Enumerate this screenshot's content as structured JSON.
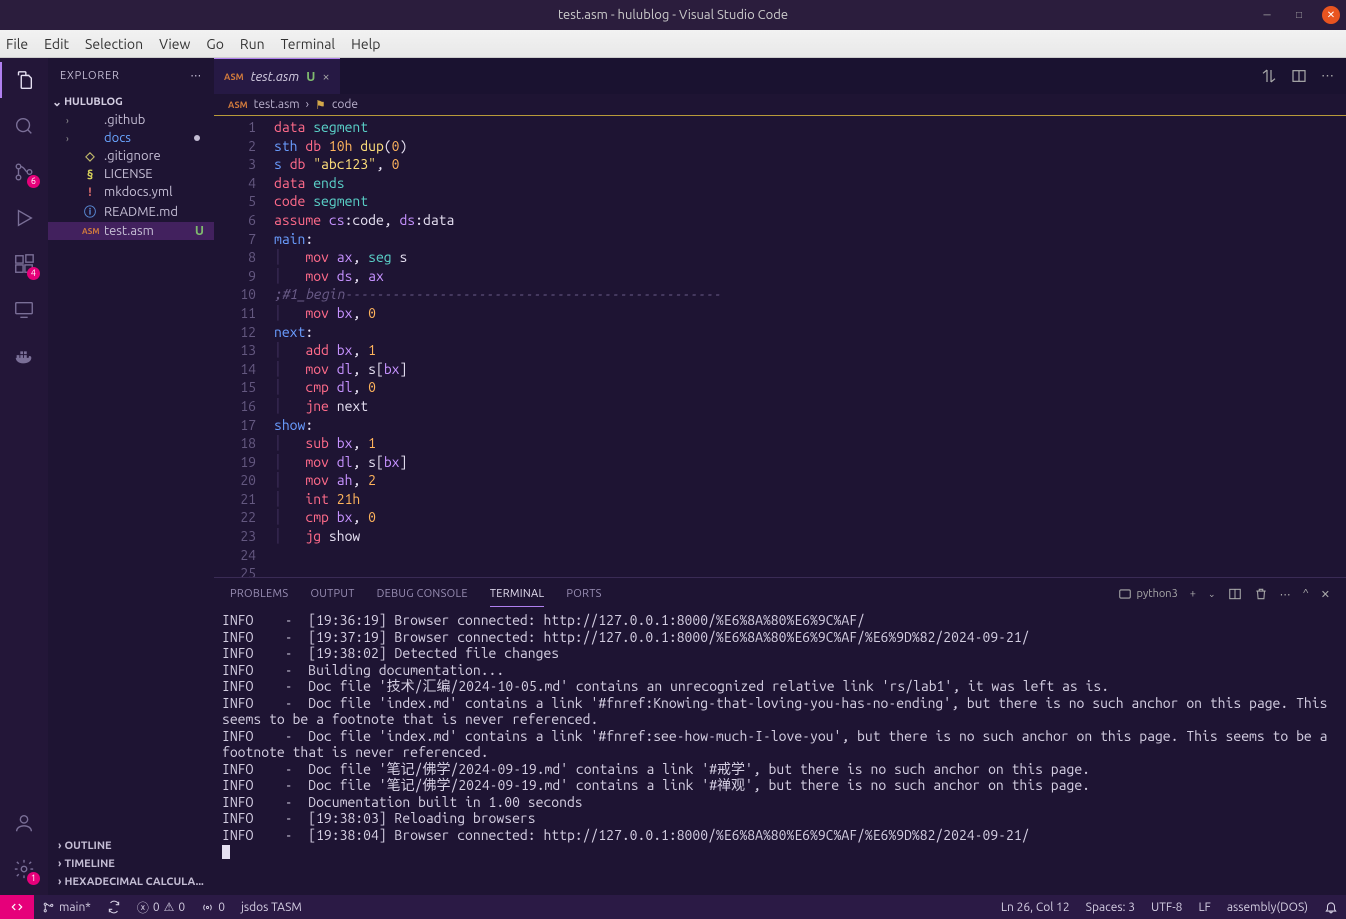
{
  "window": {
    "title": "test.asm - hulublog - Visual Studio Code"
  },
  "menu": {
    "file": "File",
    "edit": "Edit",
    "selection": "Selection",
    "view": "View",
    "go": "Go",
    "run": "Run",
    "terminal": "Terminal",
    "help": "Help"
  },
  "activity": {
    "source_control_badge": "6",
    "extensions_badge": "4",
    "settings_badge": "1"
  },
  "sidebar": {
    "header": "EXPLORER",
    "root": "HULUBLOG",
    "items": [
      {
        "chev": "›",
        "ico": "",
        "label": ".github",
        "color": "#c4bdd4"
      },
      {
        "chev": "›",
        "ico": "",
        "label": "docs",
        "color": "#6aa5ff",
        "dot": true
      },
      {
        "chev": "",
        "ico": "◇",
        "label": ".gitignore",
        "icocolor": "#c0b86a"
      },
      {
        "chev": "",
        "ico": "§",
        "label": "LICENSE",
        "icocolor": "#d6d05a"
      },
      {
        "chev": "",
        "ico": "!",
        "label": "mkdocs.yml",
        "icocolor": "#d66a6a"
      },
      {
        "chev": "",
        "ico": "ⓘ",
        "label": "README.md",
        "icocolor": "#5a8bd6"
      },
      {
        "chev": "",
        "ico": "ASM",
        "label": "test.asm",
        "icocolor": "#d27b3c",
        "mod": "U",
        "active": true
      }
    ],
    "outline": "OUTLINE",
    "timeline": "TIMELINE",
    "hexcalc": "HEXADECIMAL CALCULA..."
  },
  "tab": {
    "fileicon": "ASM",
    "filename": "test.asm",
    "mod": "U",
    "close": "×"
  },
  "breadcrumb": {
    "fileicon": "ASM",
    "file": "test.asm",
    "symicon": "⚙",
    "symbol": "code"
  },
  "code_lines": [
    [
      [
        "data ",
        "t-red"
      ],
      [
        "segment",
        "t-cyan"
      ]
    ],
    [
      [
        "sth ",
        "t-blue"
      ],
      [
        "db ",
        "t-red"
      ],
      [
        "10h ",
        "t-orange"
      ],
      [
        "dup",
        "t-yellow"
      ],
      [
        "(",
        "w"
      ],
      [
        "0",
        "t-orange"
      ],
      [
        ")",
        "w"
      ]
    ],
    [
      [
        "s ",
        "t-blue"
      ],
      [
        "db ",
        "t-red"
      ],
      [
        "\"abc123\"",
        "t-str"
      ],
      [
        ",",
        "w"
      ],
      [
        " 0",
        "t-orange"
      ]
    ],
    [
      [
        "data ",
        "t-red"
      ],
      [
        "ends",
        "t-cyan"
      ]
    ],
    [
      [
        "",
        "w"
      ]
    ],
    [
      [
        "code ",
        "t-red"
      ],
      [
        "segment",
        "t-cyan"
      ]
    ],
    [
      [
        "assume ",
        "t-red"
      ],
      [
        "cs",
        "t-purple"
      ],
      [
        ":code, ",
        "w"
      ],
      [
        "ds",
        "t-purple"
      ],
      [
        ":data",
        "w"
      ]
    ],
    [
      [
        "main",
        "t-blue"
      ],
      [
        ":",
        "w"
      ]
    ],
    [
      [
        "│   ",
        "guide"
      ],
      [
        "mov ",
        "t-red"
      ],
      [
        "ax",
        "t-purple"
      ],
      [
        ",",
        "w"
      ],
      [
        " seg ",
        "t-cyan"
      ],
      [
        "s",
        "w"
      ]
    ],
    [
      [
        "│   ",
        "guide"
      ],
      [
        "mov ",
        "t-red"
      ],
      [
        "ds",
        "t-purple"
      ],
      [
        ",",
        "w"
      ],
      [
        " ax",
        "t-purple"
      ]
    ],
    [
      [
        ";#1_begin------------------------------------------------",
        "t-comment"
      ]
    ],
    [
      [
        "│   ",
        "guide"
      ],
      [
        "mov ",
        "t-red"
      ],
      [
        "bx",
        "t-purple"
      ],
      [
        ",",
        "w"
      ],
      [
        " 0",
        "t-orange"
      ]
    ],
    [
      [
        "next",
        "t-blue"
      ],
      [
        ":",
        "w"
      ]
    ],
    [
      [
        "│   ",
        "guide"
      ],
      [
        "add ",
        "t-red"
      ],
      [
        "bx",
        "t-purple"
      ],
      [
        ",",
        "w"
      ],
      [
        " 1",
        "t-orange"
      ]
    ],
    [
      [
        "│   ",
        "guide"
      ],
      [
        "mov ",
        "t-red"
      ],
      [
        "dl",
        "t-purple"
      ],
      [
        ",",
        "w"
      ],
      [
        " s",
        "w"
      ],
      [
        "[",
        "w"
      ],
      [
        "bx",
        "t-purple"
      ],
      [
        "]",
        "w"
      ]
    ],
    [
      [
        "│   ",
        "guide"
      ],
      [
        "cmp ",
        "t-red"
      ],
      [
        "dl",
        "t-purple"
      ],
      [
        ",",
        "w"
      ],
      [
        " 0",
        "t-orange"
      ]
    ],
    [
      [
        "│   ",
        "guide"
      ],
      [
        "jne ",
        "t-red"
      ],
      [
        "next",
        "w"
      ]
    ],
    [
      [
        "",
        "w"
      ]
    ],
    [
      [
        "show",
        "t-blue"
      ],
      [
        ":",
        "w"
      ]
    ],
    [
      [
        "│   ",
        "guide"
      ],
      [
        "sub ",
        "t-red"
      ],
      [
        "bx",
        "t-purple"
      ],
      [
        ",",
        "w"
      ],
      [
        " 1",
        "t-orange"
      ]
    ],
    [
      [
        "│   ",
        "guide"
      ],
      [
        "mov ",
        "t-red"
      ],
      [
        "dl",
        "t-purple"
      ],
      [
        ",",
        "w"
      ],
      [
        " s",
        "w"
      ],
      [
        "[",
        "w"
      ],
      [
        "bx",
        "t-purple"
      ],
      [
        "]",
        "w"
      ]
    ],
    [
      [
        "│   ",
        "guide"
      ],
      [
        "mov ",
        "t-red"
      ],
      [
        "ah",
        "t-purple"
      ],
      [
        ",",
        "w"
      ],
      [
        " 2",
        "t-orange"
      ]
    ],
    [
      [
        "│   ",
        "guide"
      ],
      [
        "int ",
        "t-red"
      ],
      [
        "21h",
        "t-orange"
      ]
    ],
    [
      [
        "│   ",
        "guide"
      ],
      [
        "cmp ",
        "t-red"
      ],
      [
        "bx",
        "t-purple"
      ],
      [
        ",",
        "w"
      ],
      [
        " 0",
        "t-orange"
      ]
    ],
    [
      [
        "│   ",
        "guide"
      ],
      [
        "jg ",
        "t-red"
      ],
      [
        "show",
        "w"
      ]
    ]
  ],
  "panel": {
    "problems": "PROBLEMS",
    "output": "OUTPUT",
    "debug": "DEBUG CONSOLE",
    "terminal": "TERMINAL",
    "ports": "PORTS",
    "shell": "python3"
  },
  "terminal_lines": [
    "INFO    -  [19:36:19] Browser connected: http://127.0.0.1:8000/%E6%8A%80%E6%9C%AF/",
    "INFO    -  [19:37:19] Browser connected: http://127.0.0.1:8000/%E6%8A%80%E6%9C%AF/%E6%9D%82/2024-09-21/",
    "INFO    -  [19:38:02] Detected file changes",
    "INFO    -  Building documentation...",
    "INFO    -  Doc file '技术/汇编/2024-10-05.md' contains an unrecognized relative link 'rs/lab1', it was left as is.",
    "INFO    -  Doc file 'index.md' contains a link '#fnref:Knowing-that-loving-you-has-no-ending', but there is no such anchor on this page. This seems to be a footnote that is never referenced.",
    "INFO    -  Doc file 'index.md' contains a link '#fnref:see-how-much-I-love-you', but there is no such anchor on this page. This seems to be a footnote that is never referenced.",
    "INFO    -  Doc file '笔记/佛学/2024-09-19.md' contains a link '#戒学', but there is no such anchor on this page.",
    "INFO    -  Doc file '笔记/佛学/2024-09-19.md' contains a link '#禅观', but there is no such anchor on this page.",
    "INFO    -  Documentation built in 1.00 seconds",
    "INFO    -  [19:38:03] Reloading browsers",
    "INFO    -  [19:38:04] Browser connected: http://127.0.0.1:8000/%E6%8A%80%E6%9C%AF/%E6%9D%82/2024-09-21/"
  ],
  "status": {
    "branch": "main*",
    "sync": "",
    "errors": "0",
    "warnings": "0",
    "ports": "0",
    "framework": "jsdos TASM",
    "position": "Ln 26, Col 12",
    "spaces": "Spaces: 3",
    "encoding": "UTF-8",
    "eol": "LF",
    "lang": "assembly(DOS)"
  }
}
